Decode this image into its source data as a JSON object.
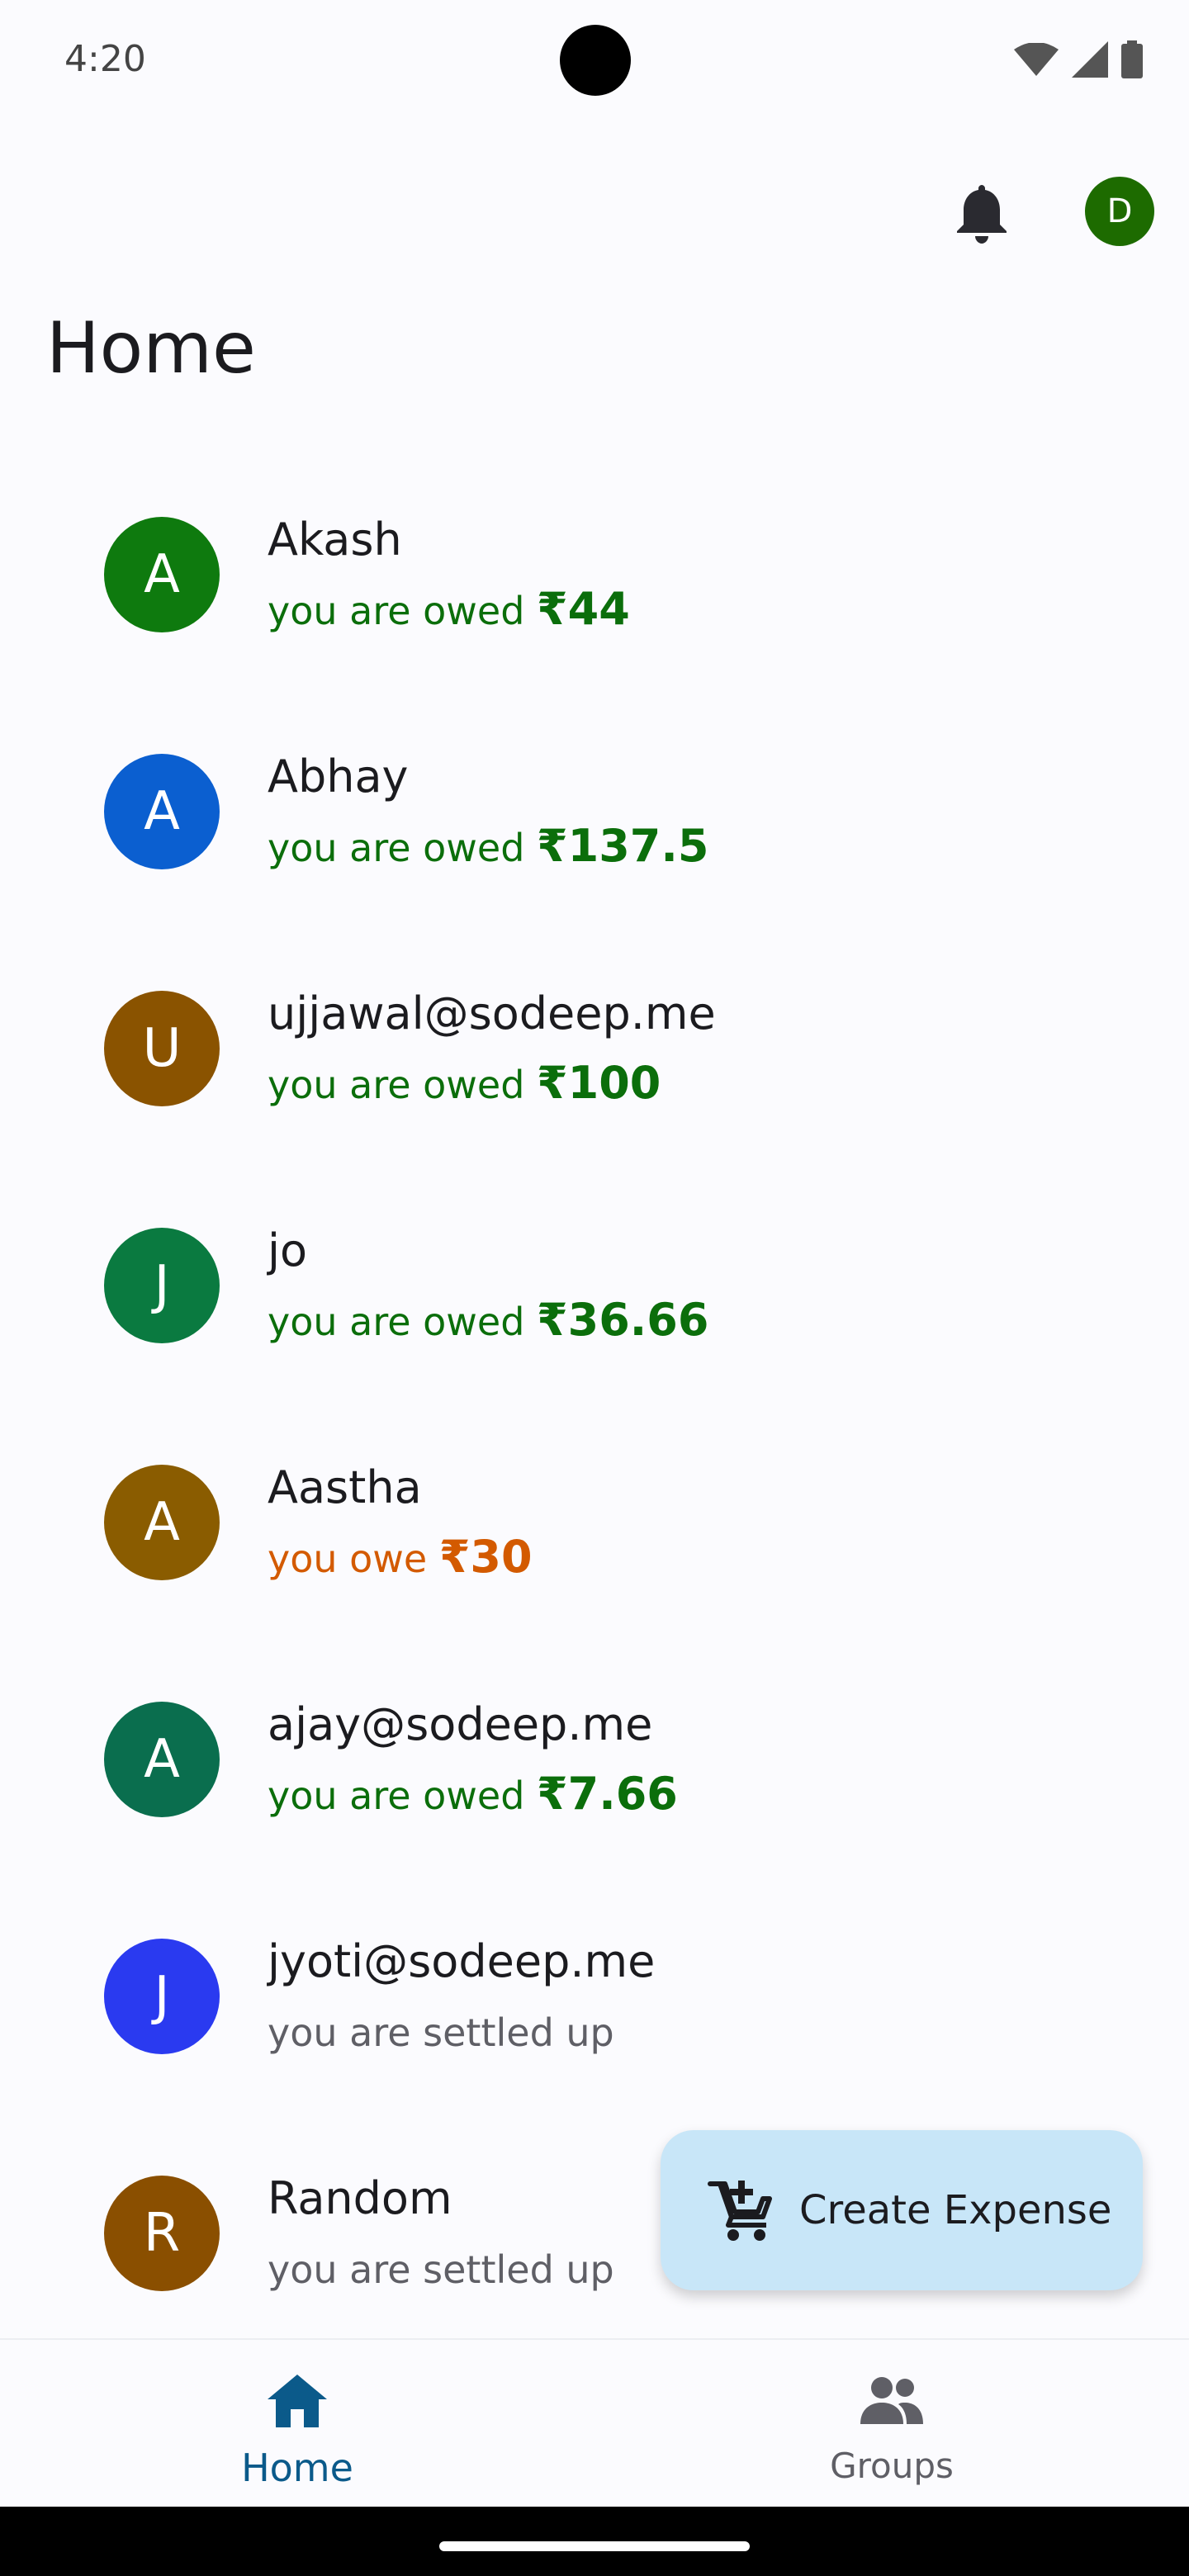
{
  "status_bar": {
    "time": "4:20"
  },
  "app_bar": {
    "profile_initial": "D",
    "profile_color": "#1d6b00"
  },
  "page": {
    "title": "Home"
  },
  "friends": [
    {
      "initial": "A",
      "name": "Akash",
      "status_prefix": "you are owed ",
      "amount": "₹44",
      "state": "owed",
      "avatar_color": "#0e7a0e"
    },
    {
      "initial": "A",
      "name": "Abhay",
      "status_prefix": "you are owed ",
      "amount": "₹137.5",
      "state": "owed",
      "avatar_color": "#0b5fd0"
    },
    {
      "initial": "U",
      "name": "ujjawal@sodeep.me",
      "status_prefix": "you are owed ",
      "amount": "₹100",
      "state": "owed",
      "avatar_color": "#8a5300"
    },
    {
      "initial": "J",
      "name": "jo",
      "status_prefix": "you are owed ",
      "amount": "₹36.66",
      "state": "owed",
      "avatar_color": "#0a7a40"
    },
    {
      "initial": "A",
      "name": "Aastha",
      "status_prefix": "you owe ",
      "amount": "₹30",
      "state": "owe",
      "avatar_color": "#8a5c00"
    },
    {
      "initial": "A",
      "name": "ajay@sodeep.me",
      "status_prefix": "you are owed ",
      "amount": "₹7.66",
      "state": "owed",
      "avatar_color": "#0a6e4e"
    },
    {
      "initial": "J",
      "name": "jyoti@sodeep.me",
      "status_prefix": "you are settled up",
      "amount": "",
      "state": "settled",
      "avatar_color": "#2a3af0"
    },
    {
      "initial": "R",
      "name": "Random",
      "status_prefix": "you are settled up",
      "amount": "",
      "state": "settled",
      "avatar_color": "#8a4f00"
    }
  ],
  "fab": {
    "label": "Create Expense",
    "icon": "add-shopping-cart-icon"
  },
  "bottom_nav": {
    "home_label": "Home",
    "groups_label": "Groups"
  },
  "colors": {
    "owed": "#0b6e0b",
    "owe": "#d35a00",
    "settled": "#5f5f66",
    "fab_bg": "#c8e6f8",
    "nav_active": "#0b5a8a"
  }
}
